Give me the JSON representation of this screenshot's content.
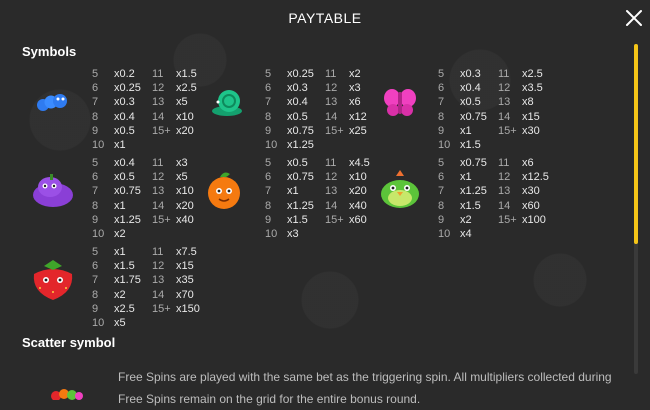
{
  "title": "PAYTABLE",
  "sections": {
    "symbols": "Symbols",
    "scatter": "Scatter symbol"
  },
  "symbols": [
    {
      "icon": "blue-worm-icon",
      "color": "#2f7bf0",
      "left": [
        [
          "5",
          "x0.2"
        ],
        [
          "6",
          "x0.25"
        ],
        [
          "7",
          "x0.3"
        ],
        [
          "8",
          "x0.4"
        ],
        [
          "9",
          "x0.5"
        ],
        [
          "10",
          "x1"
        ]
      ],
      "right": [
        [
          "11",
          "x1.5"
        ],
        [
          "12",
          "x2.5"
        ],
        [
          "13",
          "x5"
        ],
        [
          "14",
          "x10"
        ],
        [
          "15+",
          "x20"
        ]
      ]
    },
    {
      "icon": "green-snail-icon",
      "color": "#1ec48a",
      "left": [
        [
          "5",
          "x0.25"
        ],
        [
          "6",
          "x0.3"
        ],
        [
          "7",
          "x0.4"
        ],
        [
          "8",
          "x0.5"
        ],
        [
          "9",
          "x0.75"
        ],
        [
          "10",
          "x1.25"
        ]
      ],
      "right": [
        [
          "11",
          "x2"
        ],
        [
          "12",
          "x3"
        ],
        [
          "13",
          "x6"
        ],
        [
          "14",
          "x12"
        ],
        [
          "15+",
          "x25"
        ]
      ]
    },
    {
      "icon": "pink-butterfly-icon",
      "color": "#f040c0",
      "left": [
        [
          "5",
          "x0.3"
        ],
        [
          "6",
          "x0.4"
        ],
        [
          "7",
          "x0.5"
        ],
        [
          "8",
          "x0.75"
        ],
        [
          "9",
          "x1"
        ],
        [
          "10",
          "x1.5"
        ]
      ],
      "right": [
        [
          "11",
          "x2.5"
        ],
        [
          "12",
          "x3.5"
        ],
        [
          "13",
          "x8"
        ],
        [
          "14",
          "x15"
        ],
        [
          "15+",
          "x30"
        ]
      ]
    },
    {
      "icon": "purple-grape-creature-icon",
      "color": "#8a3fd6",
      "left": [
        [
          "5",
          "x0.4"
        ],
        [
          "6",
          "x0.5"
        ],
        [
          "7",
          "x0.75"
        ],
        [
          "8",
          "x1"
        ],
        [
          "9",
          "x1.25"
        ],
        [
          "10",
          "x2"
        ]
      ],
      "right": [
        [
          "11",
          "x3"
        ],
        [
          "12",
          "x5"
        ],
        [
          "13",
          "x10"
        ],
        [
          "14",
          "x20"
        ],
        [
          "15+",
          "x40"
        ]
      ]
    },
    {
      "icon": "orange-fruit-creature-icon",
      "color": "#f57a10",
      "left": [
        [
          "5",
          "x0.5"
        ],
        [
          "6",
          "x0.75"
        ],
        [
          "7",
          "x1"
        ],
        [
          "8",
          "x1.25"
        ],
        [
          "9",
          "x1.5"
        ],
        [
          "10",
          "x3"
        ]
      ],
      "right": [
        [
          "11",
          "x4.5"
        ],
        [
          "12",
          "x10"
        ],
        [
          "13",
          "x20"
        ],
        [
          "14",
          "x40"
        ],
        [
          "15+",
          "x60"
        ]
      ]
    },
    {
      "icon": "green-bird-creature-icon",
      "color": "#5cc43a",
      "left": [
        [
          "5",
          "x0.75"
        ],
        [
          "6",
          "x1"
        ],
        [
          "7",
          "x1.25"
        ],
        [
          "8",
          "x1.5"
        ],
        [
          "9",
          "x2"
        ],
        [
          "10",
          "x4"
        ]
      ],
      "right": [
        [
          "11",
          "x6"
        ],
        [
          "12",
          "x12.5"
        ],
        [
          "13",
          "x30"
        ],
        [
          "14",
          "x60"
        ],
        [
          "15+",
          "x100"
        ]
      ]
    },
    {
      "icon": "red-strawberry-creature-icon",
      "color": "#e3262b",
      "left": [
        [
          "5",
          "x1"
        ],
        [
          "6",
          "x1.5"
        ],
        [
          "7",
          "x1.75"
        ],
        [
          "8",
          "x2"
        ],
        [
          "9",
          "x2.5"
        ],
        [
          "10",
          "x5"
        ]
      ],
      "right": [
        [
          "11",
          "x7.5"
        ],
        [
          "12",
          "x15"
        ],
        [
          "13",
          "x35"
        ],
        [
          "14",
          "x70"
        ],
        [
          "15+",
          "x150"
        ]
      ]
    }
  ],
  "scatter_text": "Free Spins are played with the same bet as the triggering spin. All multipliers collected during Free Spins remain on the grid for the entire bonus round."
}
